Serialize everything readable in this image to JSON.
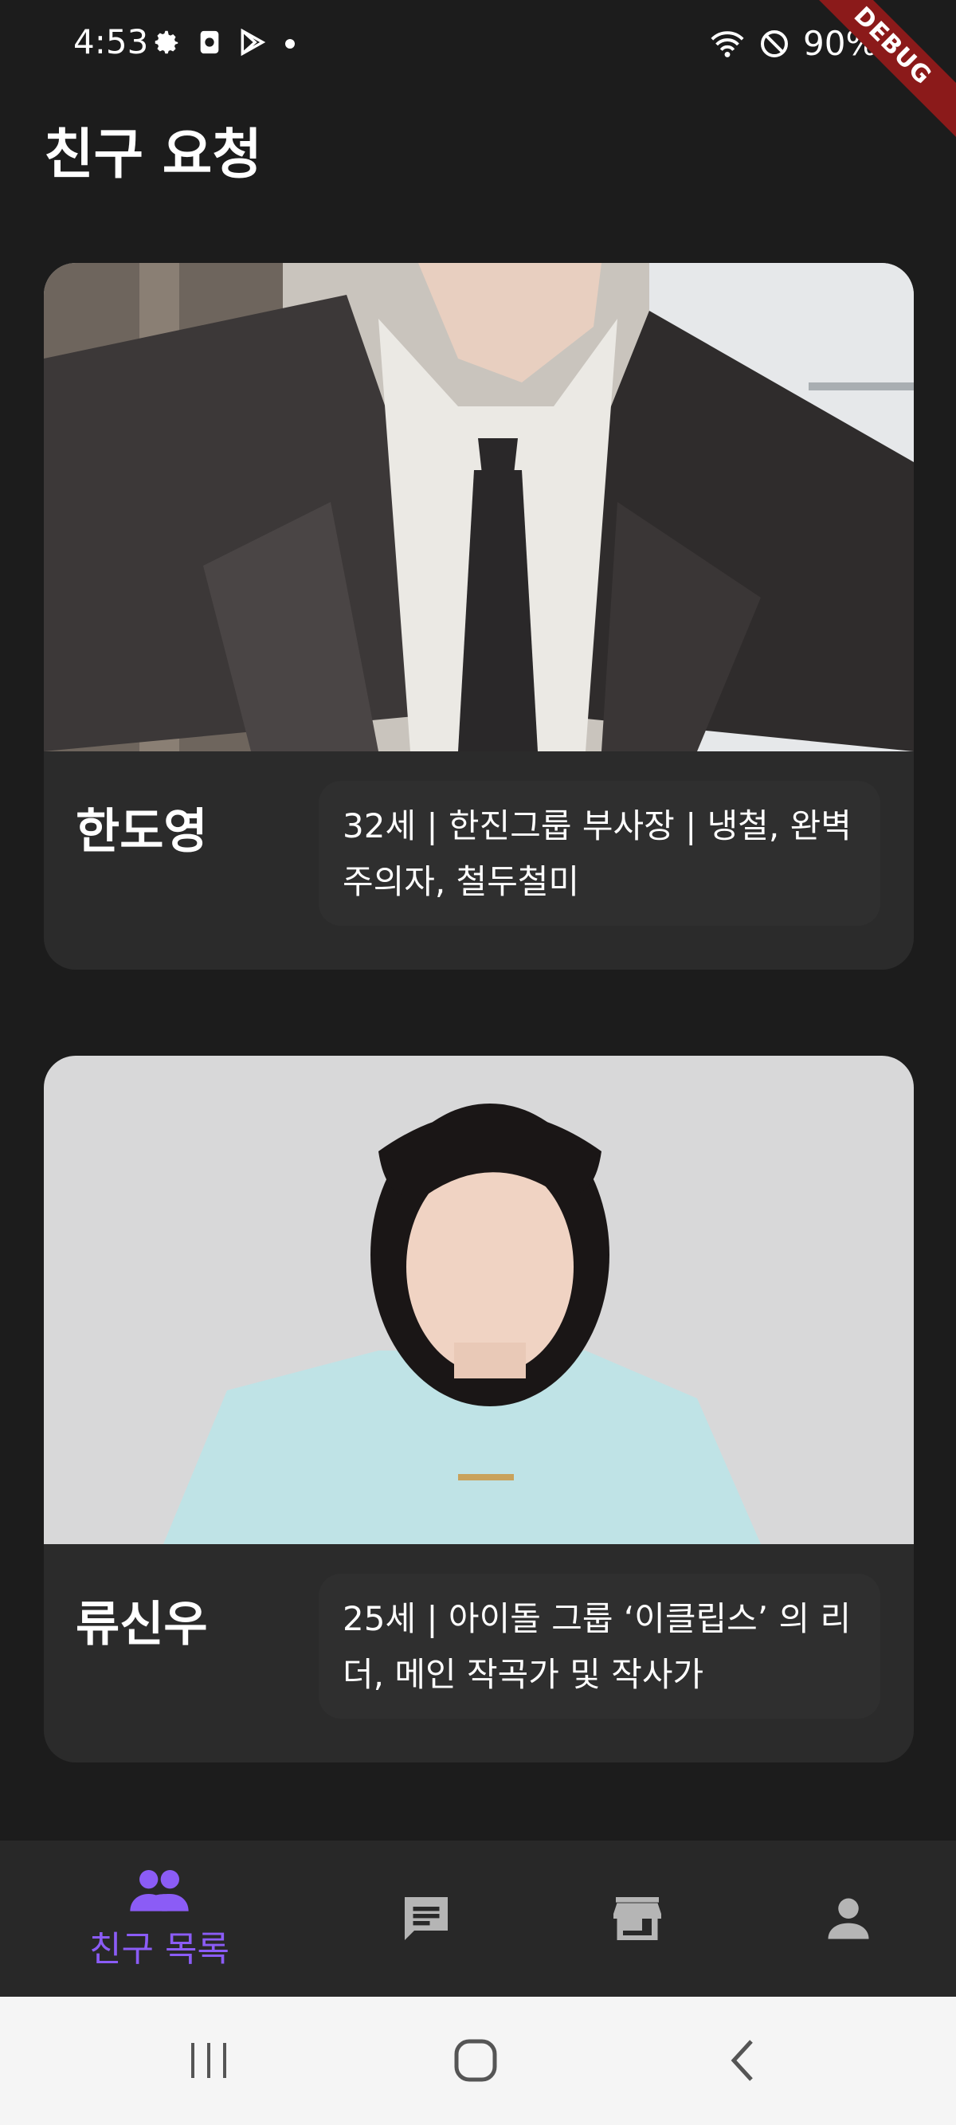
{
  "status_bar": {
    "time": "4:53",
    "battery": "90%",
    "debug_label": "DEBUG"
  },
  "page": {
    "title": "친구 요청"
  },
  "friends": [
    {
      "name": "한도영",
      "description": "32세 | 한진그룹 부사장 | 냉철, 완벽주의자, 철두철미"
    },
    {
      "name": "류신우",
      "description": "25세 | 아이돌 그룹 ‘이클립스’ 의 리더, 메인 작곡가 및 작사가"
    }
  ],
  "bottom_nav": {
    "items": [
      {
        "icon": "people-icon",
        "label": "친구 목록",
        "active": true,
        "color": "#8b5cf6"
      },
      {
        "icon": "chat-icon",
        "label": "",
        "active": false
      },
      {
        "icon": "store-icon",
        "label": "",
        "active": false
      },
      {
        "icon": "person-icon",
        "label": "",
        "active": false
      }
    ]
  },
  "colors": {
    "background": "#1c1c1c",
    "card": "#2b2b2b",
    "accent": "#8b5cf6",
    "nav_inactive": "#b5b5b5"
  }
}
